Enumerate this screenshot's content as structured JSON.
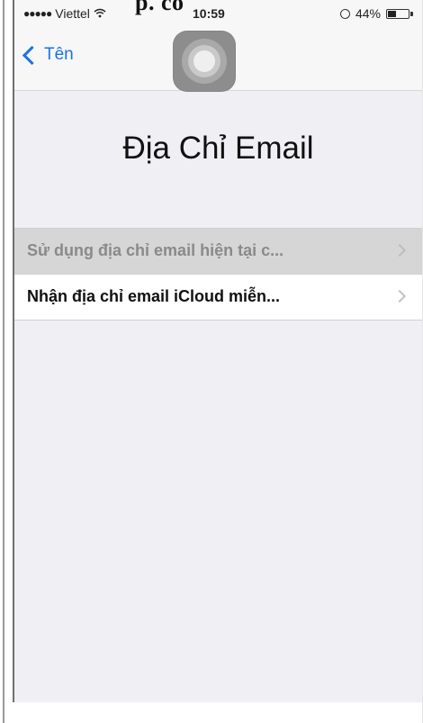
{
  "overlay_heading": "p. co",
  "status_bar": {
    "signal": "●●●●●",
    "carrier": "Viettel",
    "wifi_icon": "wifi-icon",
    "time": "10:59",
    "rotation_lock_icon": "rotation-lock-icon",
    "battery_percent": "44%",
    "battery_level": 0.44
  },
  "nav": {
    "back_label": "Tên"
  },
  "page": {
    "title": "Địa Chỉ Email"
  },
  "options": [
    {
      "label": "Sử dụng địa chỉ email hiện tại c...",
      "selected": true
    },
    {
      "label": "Nhận địa chỉ email iCloud miễn...",
      "selected": false
    }
  ],
  "colors": {
    "accent": "#1a73e8",
    "selected_row": "#d6d6d6",
    "background": "#efeff4"
  }
}
